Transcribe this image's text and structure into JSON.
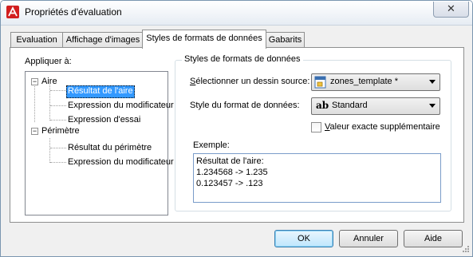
{
  "window": {
    "title": "Propriétés d'évaluation",
    "close_glyph": "✕"
  },
  "tabs": [
    {
      "label": "Evaluation",
      "active": false
    },
    {
      "label": "Affichage d'images",
      "active": false
    },
    {
      "label": "Styles de formats de données",
      "active": true
    },
    {
      "label": "Gabarits",
      "active": false
    }
  ],
  "apply": {
    "label": "Appliquer à:",
    "tree": {
      "aire": {
        "label": "Aire",
        "expander": "−",
        "children": [
          "Résultat de l'aire",
          "Expression du modificateur",
          "Expression d'essai"
        ]
      },
      "perimetre": {
        "label": "Périmètre",
        "expander": "−",
        "children": [
          "Résultat du périmètre",
          "Expression du modificateur"
        ]
      },
      "selected": "Résultat de l'aire"
    }
  },
  "group": {
    "title": "Styles de formats de données",
    "source_label_prefix": "S",
    "source_label_rest": "électionner un dessin source:",
    "source_value": "zones_template *",
    "style_label": "Style du format de données:",
    "style_value": "Standard",
    "style_icon_glyph": "ab",
    "checkbox_label_prefix": "V",
    "checkbox_label_rest": "aleur exacte supplémentaire",
    "checkbox_checked": false,
    "example_label": "Exemple:",
    "example_lines": [
      "Résultat de l'aire:",
      "1.234568 -> 1.235",
      "0.123457 -> .123"
    ]
  },
  "buttons": {
    "ok": "OK",
    "cancel": "Annuler",
    "help": "Aide"
  },
  "colors": {
    "selection": "#3399ff",
    "accent_icon": "#d21f1f"
  }
}
